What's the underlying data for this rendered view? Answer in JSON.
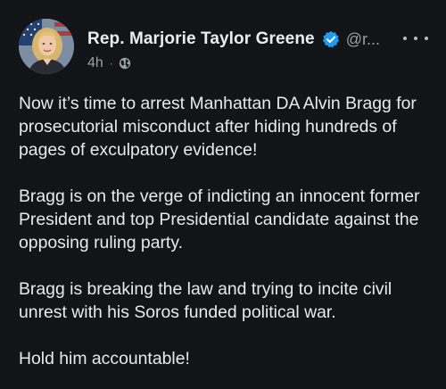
{
  "post": {
    "author": {
      "display_name": "Rep. Marjorie Taylor Greene",
      "handle": "@r...",
      "verified": true,
      "verified_color": "#1d9bf0"
    },
    "timestamp": "4h",
    "separator": "·",
    "visibility_icon": "globe-icon",
    "more_icon": "more-options-icon",
    "body": {
      "paragraphs": [
        "Now it’s time to arrest Manhattan DA Alvin Bragg for prosecutorial misconduct after hiding hundreds of pages of exculpatory evidence!",
        "Bragg is on the verge of indicting an innocent former President and top Presidential candidate against the opposing ruling party.",
        "Bragg is breaking the law and trying to incite civil unrest with his Soros funded political war.",
        "Hold him accountable!"
      ]
    }
  },
  "colors": {
    "background": "#121417",
    "text_primary": "#e9eaeb",
    "text_secondary": "#9aa0a6"
  }
}
